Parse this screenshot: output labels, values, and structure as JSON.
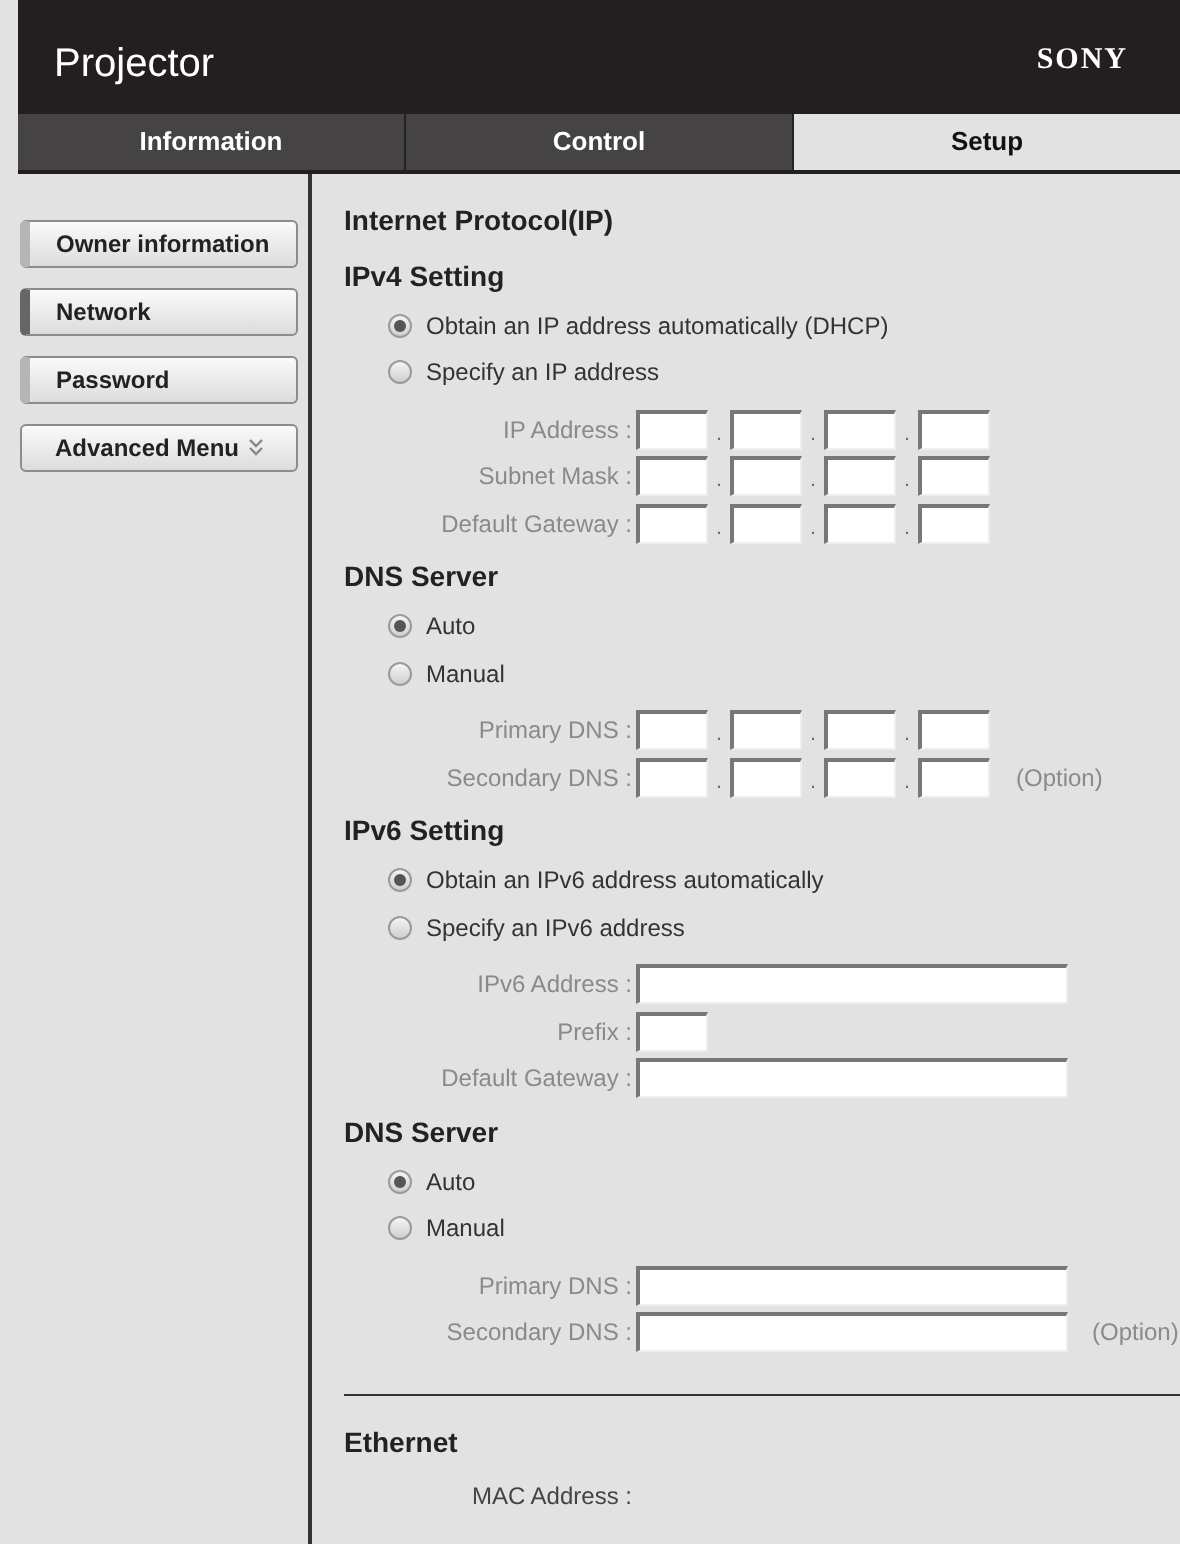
{
  "header": {
    "title": "Projector",
    "brand": "SONY"
  },
  "tabs": [
    {
      "label": "Information",
      "selected": false
    },
    {
      "label": "Control",
      "selected": false
    },
    {
      "label": "Setup",
      "selected": true
    }
  ],
  "sidebar": {
    "items": [
      {
        "label": "Owner information",
        "selected": false,
        "kind": "page"
      },
      {
        "label": "Network",
        "selected": true,
        "kind": "page"
      },
      {
        "label": "Password",
        "selected": false,
        "kind": "page"
      },
      {
        "label": "Advanced Menu",
        "selected": false,
        "kind": "menu"
      }
    ]
  },
  "content": {
    "title": "Internet Protocol(IP)",
    "rows": [
      {
        "kind": "heading",
        "label": "IPv4 Setting"
      },
      {
        "kind": "radio",
        "label": "Obtain an IP address automatically (DHCP)",
        "selected": true
      },
      {
        "kind": "radio",
        "label": "Specify an IP address",
        "selected": false
      },
      {
        "kind": "ip",
        "label": "IP Address :",
        "separator": "."
      },
      {
        "kind": "ip",
        "label": "Subnet Mask :",
        "separator": "."
      },
      {
        "kind": "ip",
        "label": "Default Gateway :",
        "separator": "."
      },
      {
        "kind": "heading",
        "label": "DNS Server"
      },
      {
        "kind": "radio",
        "label": "Auto",
        "selected": true
      },
      {
        "kind": "radio",
        "label": "Manual",
        "selected": false
      },
      {
        "kind": "ip",
        "label": "Primary DNS :",
        "separator": "."
      },
      {
        "kind": "ip",
        "label": "Secondary DNS :",
        "separator": ".",
        "note": "(Option)"
      },
      {
        "kind": "heading",
        "label": "IPv6 Setting"
      },
      {
        "kind": "radio",
        "label": "Obtain an IPv6 address automatically",
        "selected": true
      },
      {
        "kind": "radio",
        "label": "Specify an IPv6 address",
        "selected": false
      },
      {
        "kind": "wide-text",
        "label": "IPv6 Address :"
      },
      {
        "kind": "narrow-text",
        "label": "Prefix :"
      },
      {
        "kind": "wide-text",
        "label": "Default Gateway :"
      },
      {
        "kind": "heading",
        "label": "DNS Server"
      },
      {
        "kind": "radio",
        "label": "Auto",
        "selected": true
      },
      {
        "kind": "radio",
        "label": "Manual",
        "selected": false
      },
      {
        "kind": "wide-text",
        "label": "Primary DNS :"
      },
      {
        "kind": "wide-text",
        "label": "Secondary DNS :",
        "note": "(Option)"
      },
      {
        "kind": "divider"
      },
      {
        "kind": "heading",
        "label": "Ethernet"
      },
      {
        "kind": "info",
        "label": "MAC Address :"
      }
    ]
  }
}
